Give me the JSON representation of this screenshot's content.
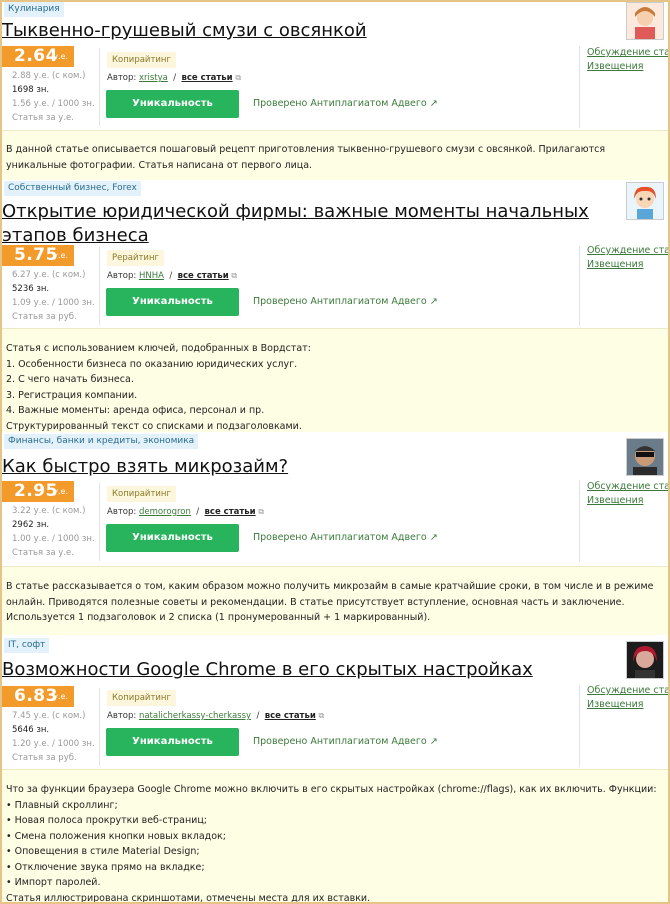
{
  "labels": {
    "unit": "у.е.",
    "author_prefix": "Автор:",
    "all_articles": "все статьи",
    "uniqueness_button": "Уникальность проверена",
    "checked_link": "Проверено Антиплагиатом Адвего",
    "discussion_link": "Обсуждение статьи",
    "notices_link": "Извещения"
  },
  "articles": [
    {
      "category": "Кулинария",
      "title": "Тыквенно-грушевый смузи с овсянкой",
      "price": "2.64",
      "price_with_commission": "2.88 у.е. (с ком.)",
      "chars": "1698 зн.",
      "price_per_1000": "1.56 у.е. / 1000 зн.",
      "price_type": "Статья за у.е.",
      "type": "Копирайтинг",
      "author": "xristya",
      "description": "В данной статье описывается пошаговый рецепт приготовления тыквенно-грушевого смузи с овсянкой. Прилагаются уникальные фотографии. Статья написана от первого лица."
    },
    {
      "category": "Собственный бизнес, Forex",
      "title": "Открытие юридической фирмы: важные моменты начальных этапов бизнеса",
      "price": "5.75",
      "price_with_commission": "6.27 у.е. (с ком.)",
      "chars": "5236 зн.",
      "price_per_1000": "1.09 у.е. / 1000 зн.",
      "price_type": "Статья за руб.",
      "type": "Рерайтинг",
      "author": "HNHA",
      "description": "Статья с использованием ключей, подобранных в Вордстат:\n1. Особенности бизнеса по оказанию юридических услуг.\n2. С чего начать бизнеса.\n3. Регистрация компании.\n4. Важные моменты: аренда офиса, персонал и пр.\nСтруктурированный текст со списками и подзаголовками."
    },
    {
      "category": "Финансы, банки и кредиты, экономика",
      "title": "Как быстро взять микрозайм?",
      "price": "2.95",
      "price_with_commission": "3.22 у.е. (с ком.)",
      "chars": "2962 зн.",
      "price_per_1000": "1.00 у.е. / 1000 зн.",
      "price_type": "Статья за у.е.",
      "type": "Копирайтинг",
      "author": "demorogron",
      "description": "В статье рассказывается о том, каким образом можно получить микрозайм в самые кратчайшие сроки, в том числе и в режиме онлайн. Приводятся полезные советы и рекомендации. В статье присутствует вступление, основная часть и заключение. Используется 1 подзаголовок и 2 списка (1 пронумерованный + 1 маркированный)."
    },
    {
      "category": "IT, софт",
      "title": "Возможности Google Chrome в его скрытых настройках",
      "price": "6.83",
      "price_with_commission": "7.45 у.е. (с ком.)",
      "chars": "5646 зн.",
      "price_per_1000": "1.20 у.е. / 1000 зн.",
      "price_type": "Статья за руб.",
      "type": "Копирайтинг",
      "author": "natalicherkassy-cherkassy",
      "description": "Что за функции браузера Google Chrome можно включить в его скрытых настройках (chrome://flags), как их включить. Функции:\n• Плавный скроллинг;\n• Новая полоса прокрутки веб-страниц;\n• Смена положения кнопки новых вкладок;\n• Оповещения в стиле Material Design;\n• Отключение звука прямо на вкладке;\n• Импорт паролей.\nСтатья иллюстрирована скриншотами, отмечены места для их вставки."
    }
  ]
}
